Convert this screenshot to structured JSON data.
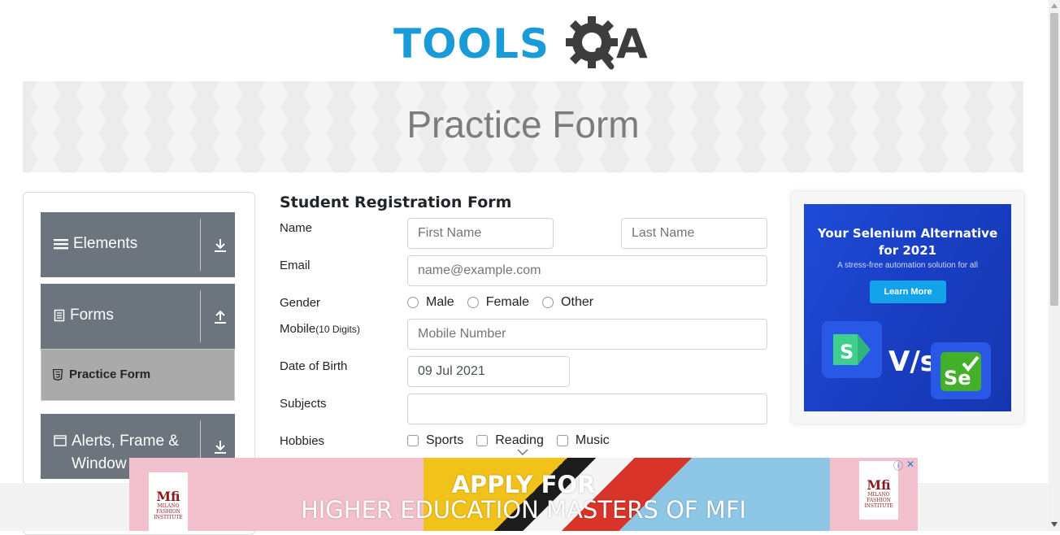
{
  "logo": {
    "brand_left": "TOOLS",
    "brand_right": "A"
  },
  "banner": {
    "title": "Practice Form"
  },
  "sidebar": {
    "groups": [
      {
        "label": "Elements",
        "icon": "hamburger-icon",
        "arrow": "download-arrow-icon"
      },
      {
        "label": "Forms",
        "icon": "document-icon",
        "arrow": "upload-arrow-icon"
      },
      {
        "label": "Alerts, Frame &",
        "label2": "Window",
        "icon": "window-icon",
        "arrow": "download-arrow-icon"
      }
    ],
    "active_item": {
      "label": "Practice Form",
      "icon": "html5-icon"
    }
  },
  "form": {
    "title": "Student Registration Form",
    "name_label": "Name",
    "first_name_placeholder": "First Name",
    "last_name_placeholder": "Last Name",
    "email_label": "Email",
    "email_placeholder": "name@example.com",
    "gender_label": "Gender",
    "gender_options": [
      "Male",
      "Female",
      "Other"
    ],
    "mobile_label": "Mobile",
    "mobile_hint": "(10 Digits)",
    "mobile_placeholder": "Mobile Number",
    "dob_label": "Date of Birth",
    "dob_value": "09 Jul 2021",
    "subjects_label": "Subjects",
    "subjects_value": "",
    "hobbies_label": "Hobbies",
    "hobby_options": [
      "Sports",
      "Reading",
      "Music"
    ]
  },
  "right_ad": {
    "title_line1": "Your Selenium Alternative",
    "title_line2": "for 2021",
    "subtitle": "A stress-free automation solution for all",
    "button": "Learn More",
    "vs": "V/s",
    "left_logo_letter": "S",
    "right_logo_text": "Se"
  },
  "bottom_ad": {
    "line1": "APPLY FOR",
    "line2": "HIGHER EDUCATION MASTERS OF MFI",
    "logo_text": "Mfi",
    "logo_sub": "MILANO FASHION INSTITUTE",
    "info_icon": "ⓘ",
    "close_icon": "✕"
  },
  "colors": {
    "brand_blue": "#1a9ad6",
    "sidebar_bg": "#6c757d",
    "active_item_bg": "#aaaaaa",
    "ad_blue": "#1e4bd8"
  }
}
